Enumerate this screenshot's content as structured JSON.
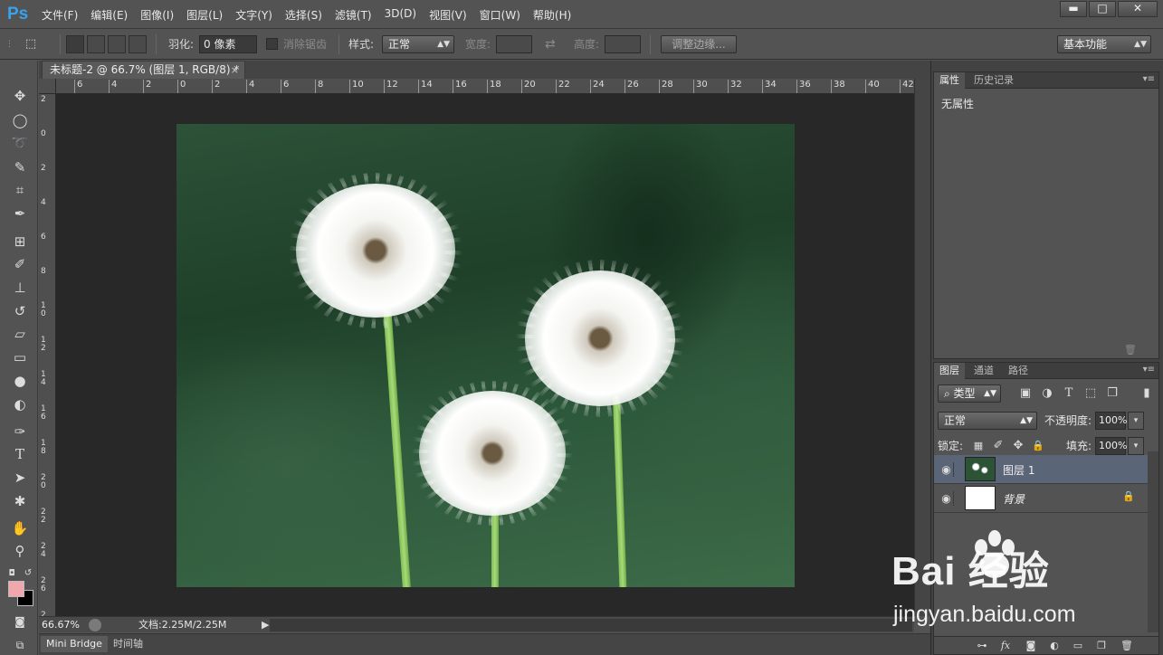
{
  "app": {
    "logo": "Ps",
    "menu": [
      "文件(F)",
      "编辑(E)",
      "图像(I)",
      "图层(L)",
      "文字(Y)",
      "选择(S)",
      "滤镜(T)",
      "3D(D)",
      "视图(V)",
      "窗口(W)",
      "帮助(H)"
    ],
    "window_controls": {
      "minimize": "▬",
      "maximize": "□",
      "close": "✕"
    }
  },
  "options": {
    "feather_label": "羽化:",
    "feather_value": "0 像素",
    "antialias_label": "消除锯齿",
    "style_label": "样式:",
    "style_value": "正常",
    "width_label": "宽度:",
    "height_label": "高度:",
    "refine_edge_label": "调整边缘...",
    "workspace_value": "基本功能"
  },
  "document": {
    "tab_title": "未标题-2 @ 66.7% (图层 1, RGB/8) *",
    "close": "×",
    "ruler_h": [
      "6",
      "4",
      "2",
      "0",
      "2",
      "4",
      "6",
      "8",
      "10",
      "12",
      "14",
      "16",
      "18",
      "20",
      "22",
      "24",
      "26",
      "28",
      "30",
      "32",
      "34",
      "36",
      "38",
      "40",
      "42"
    ],
    "ruler_v": [
      "2",
      "0",
      "2",
      "4",
      "6",
      "8",
      "1\n0",
      "1\n2",
      "1\n4",
      "1\n6",
      "1\n8",
      "2\n0",
      "2\n2",
      "2\n4",
      "2\n6",
      "2\n8"
    ]
  },
  "statusbar": {
    "zoom": "66.67%",
    "doc_size": "文档:2.25M/2.25M",
    "arrow": "▶"
  },
  "bottom_tabs": [
    "Mini Bridge",
    "时间轴"
  ],
  "properties_panel": {
    "tabs": [
      "属性",
      "历史记录"
    ],
    "empty_text": "无属性"
  },
  "layers_panel": {
    "tabs": [
      "图层",
      "通道",
      "路径"
    ],
    "filter_value": "类型",
    "blend_mode": "正常",
    "opacity_label": "不透明度:",
    "opacity_value": "100%",
    "lock_label": "锁定:",
    "fill_label": "填充:",
    "fill_value": "100%",
    "layers": [
      {
        "name": "图层 1",
        "selected": true
      },
      {
        "name": "背景",
        "selected": false,
        "locked": true
      }
    ]
  },
  "watermark": {
    "brand": "Bai  经验",
    "domain": "jingyan.baidu.com"
  },
  "colors": {
    "foreground": "#f2a6ae",
    "background": "#000000",
    "accent_logo": "#38a2ef",
    "selected_layer": "#5b6578"
  },
  "icons": {
    "tools": [
      "move-icon",
      "ellipse-marquee-icon",
      "lasso-icon",
      "quick-select-icon",
      "crop-icon",
      "eyedropper-icon",
      "spot-heal-icon",
      "brush-icon",
      "clone-stamp-icon",
      "history-brush-icon",
      "eraser-icon",
      "gradient-icon",
      "blur-icon",
      "dodge-icon",
      "pen-icon",
      "type-icon",
      "path-select-icon",
      "shape-icon",
      "hand-icon",
      "zoom-icon"
    ]
  }
}
